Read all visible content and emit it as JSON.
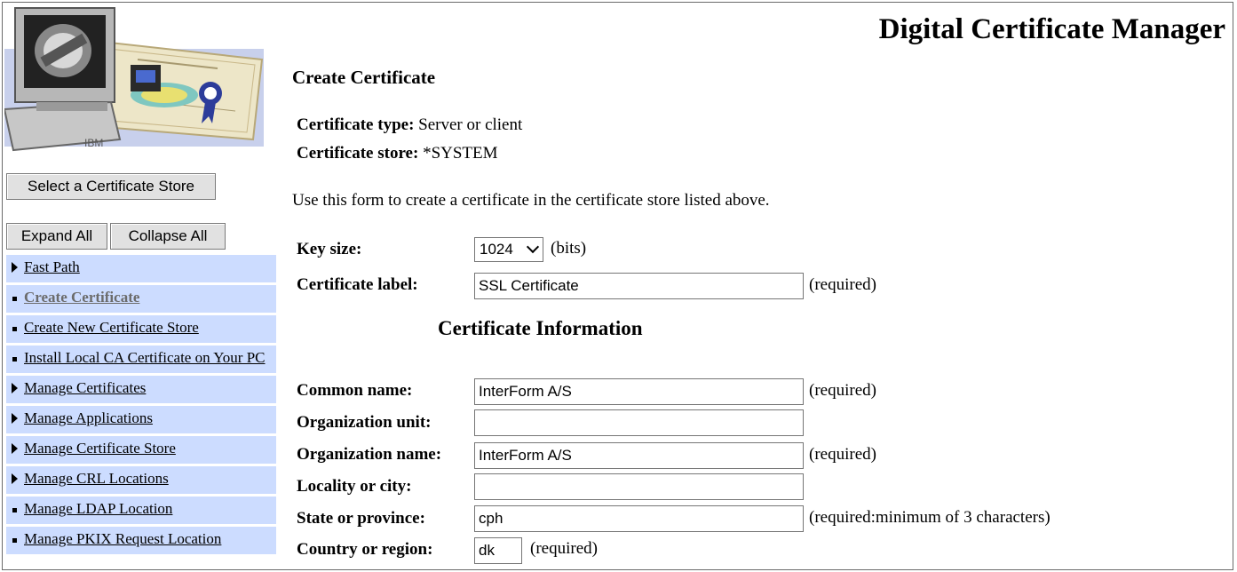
{
  "header": {
    "title": "Digital Certificate Manager"
  },
  "sidebar": {
    "select_store_button": "Select a Certificate Store",
    "expand_all_button": "Expand All",
    "collapse_all_button": "Collapse All",
    "items": [
      {
        "label": "Fast Path",
        "marker": "triangle"
      },
      {
        "label": "Create Certificate",
        "marker": "square",
        "active": true
      },
      {
        "label": "Create New Certificate Store",
        "marker": "square"
      },
      {
        "label": "Install Local CA Certificate on Your PC",
        "marker": "square"
      },
      {
        "label": "Manage Certificates",
        "marker": "triangle"
      },
      {
        "label": "Manage Applications",
        "marker": "triangle"
      },
      {
        "label": "Manage Certificate Store",
        "marker": "triangle"
      },
      {
        "label": "Manage CRL Locations",
        "marker": "triangle"
      },
      {
        "label": "Manage LDAP Location",
        "marker": "square"
      },
      {
        "label": "Manage PKIX Request Location",
        "marker": "square"
      }
    ]
  },
  "main": {
    "page_title": "Create Certificate",
    "cert_type_label": "Certificate type:",
    "cert_type_value": "Server or client",
    "cert_store_label": "Certificate store:",
    "cert_store_value": "*SYSTEM",
    "description": "Use this form to create a certificate in the certificate store listed above.",
    "key_size": {
      "label": "Key size:",
      "selected": "1024",
      "unit": "(bits)"
    },
    "cert_label": {
      "label": "Certificate label:",
      "value": "SSL Certificate",
      "note": "(required)"
    },
    "section_title": "Certificate Information",
    "common_name": {
      "label": "Common name:",
      "value": "InterForm A/S",
      "note": "(required)"
    },
    "org_unit": {
      "label": "Organization unit:",
      "value": ""
    },
    "org_name": {
      "label": "Organization name:",
      "value": "InterForm A/S",
      "note": "(required)"
    },
    "locality": {
      "label": "Locality or city:",
      "value": ""
    },
    "state": {
      "label": "State or province:",
      "value": "cph",
      "note": "(required:minimum of 3 characters)"
    },
    "country": {
      "label": "Country or region:",
      "value": "dk",
      "note": "(required)"
    }
  },
  "colors": {
    "nav_bg": "#ccdcff",
    "active_link": "#6b6b6b",
    "button_bg": "#e1e1e1"
  }
}
